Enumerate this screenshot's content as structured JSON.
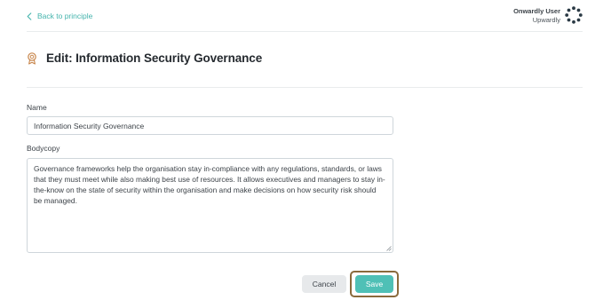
{
  "nav": {
    "back_label": "Back to principle",
    "back_icon": "chevron-left-icon"
  },
  "user": {
    "name": "Onwardly User",
    "org": "Upwardly",
    "logo_icon": "dotted-ring-logo"
  },
  "page": {
    "title": "Edit: Information Security Governance",
    "title_icon": "award-badge-icon"
  },
  "form": {
    "name_label": "Name",
    "name_value": "Information Security Governance",
    "bodycopy_label": "Bodycopy",
    "bodycopy_value": "Governance frameworks help the organisation stay in-compliance with any regulations, standards, or laws that they must meet while also making best use of resources. It allows executives and managers to stay in-the-know on the state of security within the organisation and make decisions on how security risk should be managed."
  },
  "actions": {
    "cancel_label": "Cancel",
    "save_label": "Save"
  },
  "colors": {
    "accent": "#43b3ac",
    "save": "#4fc0b6",
    "title_icon": "#c8864c",
    "focus_ring": "#8a6a3c",
    "logo": "#2b3a45"
  }
}
